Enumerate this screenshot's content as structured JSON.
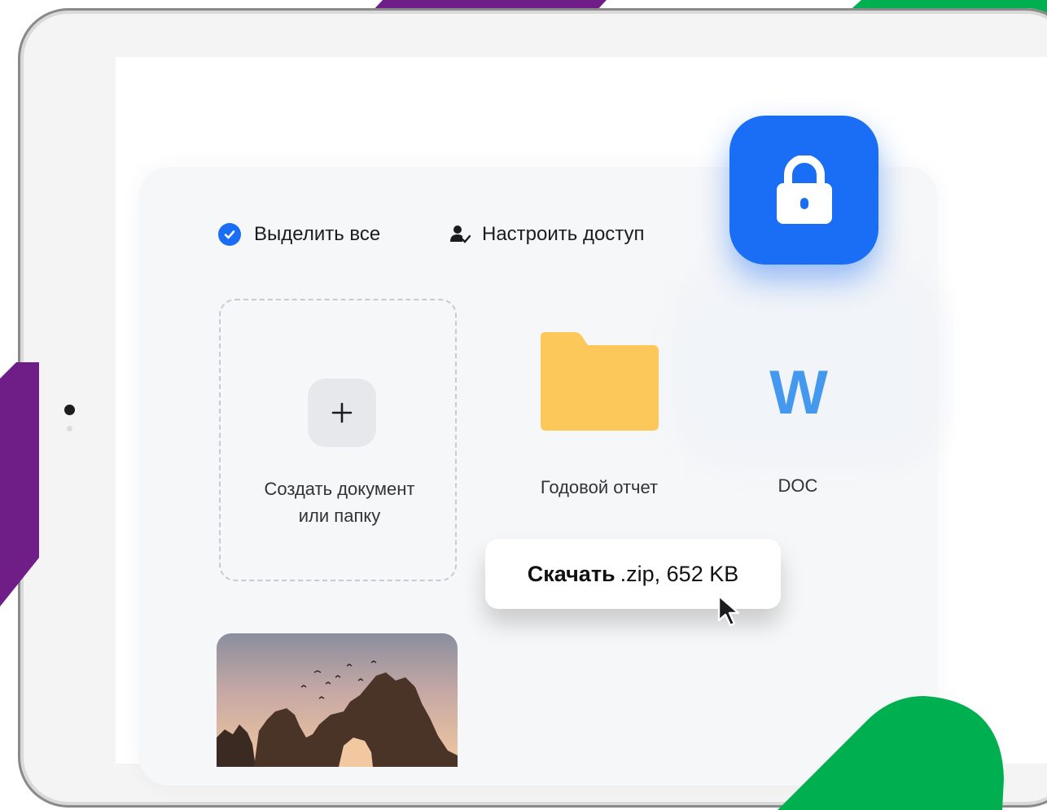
{
  "toolbar": {
    "select_all": "Выделить все",
    "configure_access": "Настроить доступ"
  },
  "files": {
    "create_label_line1": "Создать документ",
    "create_label_line2": "или папку",
    "folder_label": "Годовой отчет",
    "doc_label": "DOC",
    "doc_letter": "W"
  },
  "download": {
    "action": "Скачать",
    "details": ".zip, 652 KB"
  },
  "colors": {
    "accent_blue": "#1a6ef5",
    "folder_yellow": "#fdc85a",
    "word_blue": "#4499ee",
    "deco_purple": "#6f1d87",
    "deco_green": "#00b050"
  },
  "icons": [
    "check-icon",
    "user-check-icon",
    "plus-icon",
    "folder-icon",
    "word-doc-icon",
    "lock-icon",
    "cursor-icon"
  ]
}
